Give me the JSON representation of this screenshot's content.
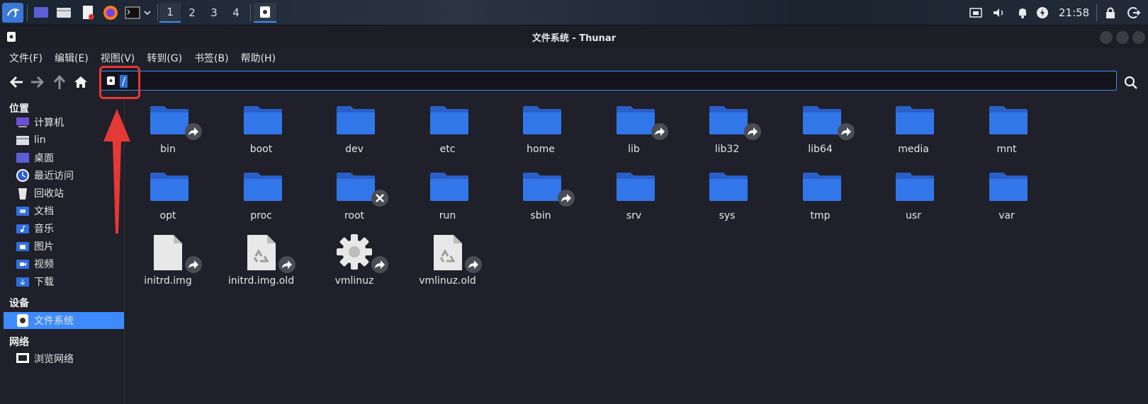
{
  "panel": {
    "workspaces": [
      "1",
      "2",
      "3",
      "4"
    ],
    "active_workspace": 0,
    "clock": "21:58"
  },
  "window": {
    "title": "文件系统 - Thunar"
  },
  "menubar": [
    "文件(F)",
    "编辑(E)",
    "视图(V)",
    "转到(G)",
    "书签(B)",
    "帮助(H)"
  ],
  "location": {
    "path": "/"
  },
  "sidebar": {
    "places_header": "位置",
    "places": [
      {
        "label": "计算机",
        "icon": "computer-icon"
      },
      {
        "label": "lin",
        "icon": "home-folder-icon"
      },
      {
        "label": "桌面",
        "icon": "desktop-icon"
      },
      {
        "label": "最近访问",
        "icon": "recent-icon"
      },
      {
        "label": "回收站",
        "icon": "trash-icon"
      },
      {
        "label": "文档",
        "icon": "documents-icon"
      },
      {
        "label": "音乐",
        "icon": "music-icon"
      },
      {
        "label": "图片",
        "icon": "pictures-icon"
      },
      {
        "label": "视频",
        "icon": "videos-icon"
      },
      {
        "label": "下载",
        "icon": "downloads-icon"
      }
    ],
    "devices_header": "设备",
    "devices": [
      {
        "label": "文件系统",
        "icon": "filesystem-icon",
        "selected": true
      }
    ],
    "network_header": "网络",
    "network": [
      {
        "label": "浏览网络",
        "icon": "network-icon"
      }
    ]
  },
  "files": [
    {
      "name": "bin",
      "type": "folder",
      "badge": "link"
    },
    {
      "name": "boot",
      "type": "folder",
      "badge": ""
    },
    {
      "name": "dev",
      "type": "folder",
      "badge": ""
    },
    {
      "name": "etc",
      "type": "folder",
      "badge": ""
    },
    {
      "name": "home",
      "type": "folder",
      "badge": ""
    },
    {
      "name": "lib",
      "type": "folder",
      "badge": "link"
    },
    {
      "name": "lib32",
      "type": "folder",
      "badge": "link"
    },
    {
      "name": "lib64",
      "type": "folder",
      "badge": "link"
    },
    {
      "name": "media",
      "type": "folder",
      "badge": ""
    },
    {
      "name": "mnt",
      "type": "folder",
      "badge": ""
    },
    {
      "name": "opt",
      "type": "folder",
      "badge": ""
    },
    {
      "name": "proc",
      "type": "folder",
      "badge": ""
    },
    {
      "name": "root",
      "type": "folder",
      "badge": "locked"
    },
    {
      "name": "run",
      "type": "folder",
      "badge": ""
    },
    {
      "name": "sbin",
      "type": "folder",
      "badge": "link"
    },
    {
      "name": "srv",
      "type": "folder",
      "badge": ""
    },
    {
      "name": "sys",
      "type": "folder",
      "badge": ""
    },
    {
      "name": "tmp",
      "type": "folder",
      "badge": ""
    },
    {
      "name": "usr",
      "type": "folder",
      "badge": ""
    },
    {
      "name": "var",
      "type": "folder",
      "badge": ""
    },
    {
      "name": "initrd.img",
      "type": "file",
      "badge": "link"
    },
    {
      "name": "initrd.img.old",
      "type": "recycle-file",
      "badge": "link"
    },
    {
      "name": "vmlinuz",
      "type": "gear",
      "badge": "link"
    },
    {
      "name": "vmlinuz.old",
      "type": "recycle-file",
      "badge": "link"
    }
  ],
  "colors": {
    "accent": "#3d8bff",
    "folder": "#2f6fe0",
    "highlight": "#e53935"
  }
}
